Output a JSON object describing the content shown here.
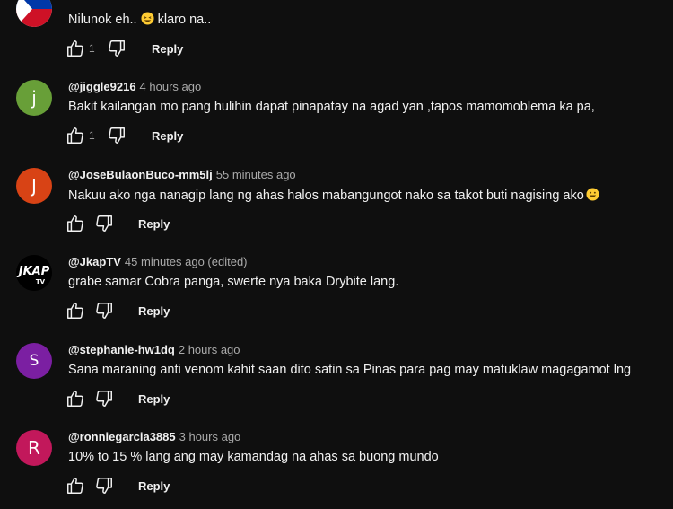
{
  "comments": [
    {
      "text": "Nilunok eh.. ",
      "text2": " klaro na..",
      "likes": "1",
      "reply": "Reply",
      "avatar_icon": "philippine-flag-icon"
    },
    {
      "handle": "@jiggle9216",
      "meta": "4 hours ago",
      "text": "Bakit kailangan mo pang hulihin dapat pinapatay na agad yan ,tapos mamomoblema ka pa,",
      "likes": "1",
      "reply": "Reply",
      "avatar_letter": "j",
      "avatar_color": "#689f38"
    },
    {
      "handle": "@JoseBulaonBuco-mm5lj",
      "meta": "55 minutes ago",
      "text": "Nakuu ako nga nanagip lang ng ahas halos mabangungot nako sa takot buti nagising  ako",
      "reply": "Reply",
      "avatar_letter": "J",
      "avatar_color": "#d84315"
    },
    {
      "handle": "@JkapTV",
      "meta": "45 minutes ago (edited)",
      "text": "grabe samar Cobra panga, swerte nya baka Drybite lang.",
      "reply": "Reply",
      "avatar_logo": "JKAP",
      "avatar_logo_sub": "TV"
    },
    {
      "handle": "@stephanie-hw1dq",
      "meta": "2 hours ago",
      "text": "Sana maraning anti venom kahit saan dito satin sa Pinas para pag may matuklaw magagamot lng",
      "reply": "Reply",
      "avatar_letter": "S",
      "avatar_color": "#7b1fa2"
    },
    {
      "handle": "@ronniegarcia3885",
      "meta": "3 hours ago",
      "text": "10% to 15 %  lang ang may kamandag na ahas sa buong mundo",
      "reply": "Reply",
      "avatar_letter": "R",
      "avatar_color": "#c2185b"
    }
  ]
}
